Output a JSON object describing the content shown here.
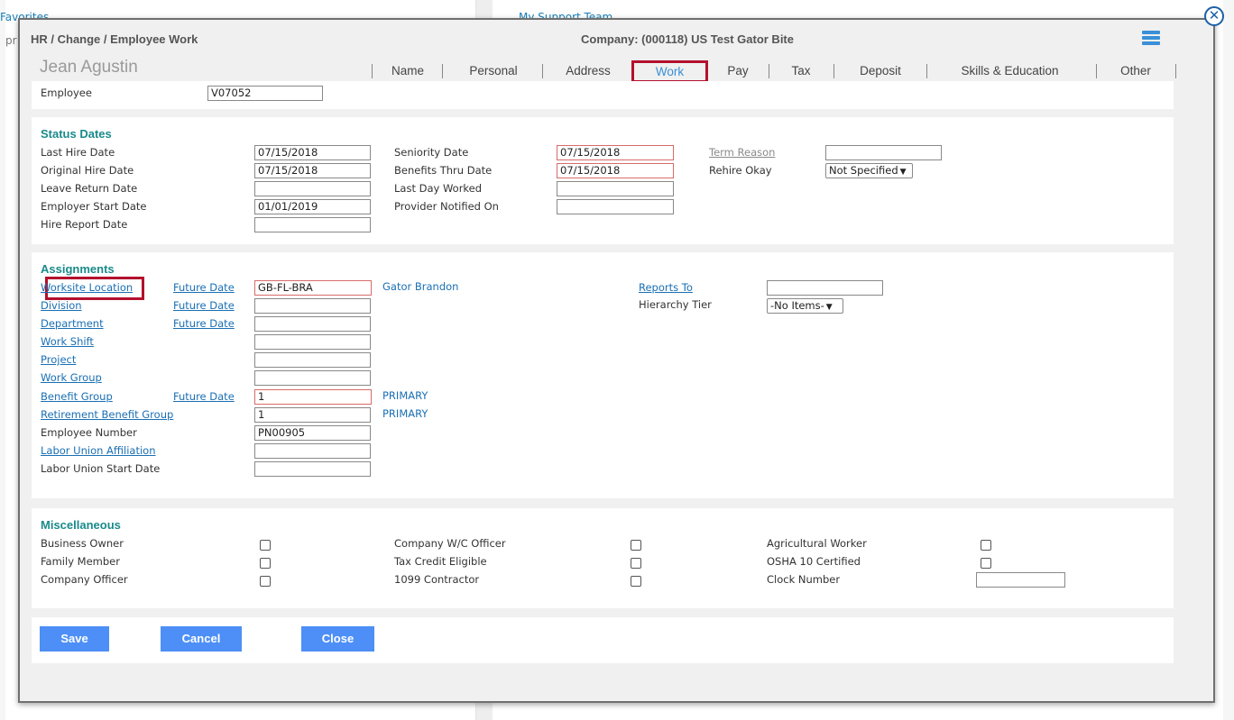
{
  "background": {
    "favorites": "Favorites",
    "pr": "pr",
    "team": "My Support Team"
  },
  "header": {
    "path": "HR / Change / Employee Work",
    "company": "Company: (000118) US Test Gator Bite",
    "employee_name": "Jean Agustin"
  },
  "tabs": [
    {
      "label": "Name"
    },
    {
      "label": "Personal"
    },
    {
      "label": "Address"
    },
    {
      "label": "Work",
      "active": true
    },
    {
      "label": "Pay"
    },
    {
      "label": "Tax"
    },
    {
      "label": "Deposit"
    },
    {
      "label": "Skills & Education"
    },
    {
      "label": "Other"
    }
  ],
  "employee": {
    "label": "Employee",
    "value": "V07052"
  },
  "status_dates": {
    "title": "Status Dates",
    "last_hire_date": {
      "label": "Last Hire Date",
      "value": "07/15/2018"
    },
    "original_hire_date": {
      "label": "Original Hire Date",
      "value": "07/15/2018"
    },
    "leave_return_date": {
      "label": "Leave Return Date",
      "value": ""
    },
    "employer_start_date": {
      "label": "Employer Start Date",
      "value": "01/01/2019"
    },
    "hire_report_date": {
      "label": "Hire Report Date",
      "value": ""
    },
    "seniority_date": {
      "label": "Seniority Date",
      "value": "07/15/2018"
    },
    "benefits_thru_date": {
      "label": "Benefits Thru Date",
      "value": "07/15/2018"
    },
    "last_day_worked": {
      "label": "Last Day Worked",
      "value": ""
    },
    "provider_notified_on": {
      "label": "Provider Notified On",
      "value": ""
    },
    "term_reason": {
      "label": "Term Reason",
      "value": ""
    },
    "rehire_okay": {
      "label": "Rehire Okay",
      "value": "Not Specified"
    }
  },
  "assignments": {
    "title": "Assignments",
    "future_date": "Future Date",
    "worksite_location": {
      "label": "Worksite Location",
      "value": "GB-FL-BRA",
      "desc": "Gator Brandon"
    },
    "division": {
      "label": "Division",
      "value": ""
    },
    "department": {
      "label": "Department",
      "value": ""
    },
    "work_shift": {
      "label": "Work Shift",
      "value": ""
    },
    "project": {
      "label": "Project",
      "value": ""
    },
    "work_group": {
      "label": "Work Group",
      "value": ""
    },
    "benefit_group": {
      "label": "Benefit Group",
      "value": "1",
      "desc": "PRIMARY"
    },
    "retirement_benefit_group": {
      "label": "Retirement Benefit Group",
      "value": "1",
      "desc": "PRIMARY"
    },
    "employee_number": {
      "label": "Employee Number",
      "value": "PN00905"
    },
    "labor_union_affiliation": {
      "label": "Labor Union Affiliation",
      "value": ""
    },
    "labor_union_start_date": {
      "label": "Labor Union Start Date",
      "value": ""
    },
    "reports_to": {
      "label": "Reports To",
      "value": ""
    },
    "hierarchy_tier": {
      "label": "Hierarchy Tier",
      "value": "-No Items-"
    }
  },
  "miscellaneous": {
    "title": "Miscellaneous",
    "business_owner": {
      "label": "Business Owner",
      "checked": false
    },
    "family_member": {
      "label": "Family Member",
      "checked": false
    },
    "company_officer": {
      "label": "Company Officer",
      "checked": false
    },
    "company_wc_officer": {
      "label": "Company W/C Officer",
      "checked": false
    },
    "tax_credit_eligible": {
      "label": "Tax Credit Eligible",
      "checked": false
    },
    "contractor_1099": {
      "label": "1099 Contractor",
      "checked": false
    },
    "agricultural_worker": {
      "label": "Agricultural Worker",
      "checked": false
    },
    "osha_10_certified": {
      "label": "OSHA 10 Certified",
      "checked": false
    },
    "clock_number": {
      "label": "Clock Number",
      "value": ""
    }
  },
  "buttons": {
    "save": "Save",
    "cancel": "Cancel",
    "close": "Close"
  },
  "colors": {
    "accent": "#4d8ff6",
    "section_title": "#1a8a8a",
    "highlight": "#b3102d",
    "link": "#1a6fb3"
  }
}
